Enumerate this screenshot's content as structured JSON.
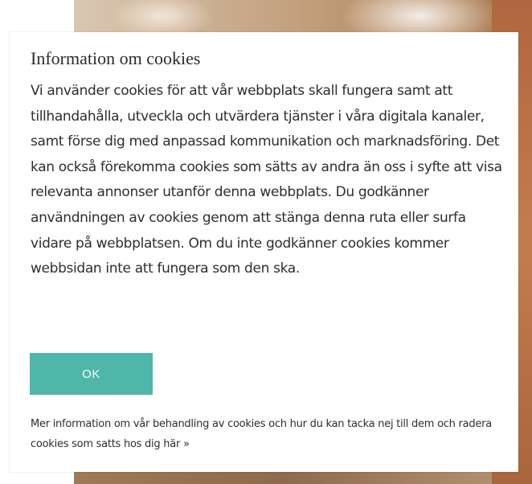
{
  "dialog": {
    "title": "Information om cookies",
    "body": "Vi använder cookies för att vår webbplats skall fungera samt att tillhandahålla, utveckla och utvärdera tjänster i våra digitala kanaler, samt förse dig med anpassad kommunikation och marknadsföring. Det kan också förekomma cookies som sätts av andra än oss i syfte att visa relevanta annonser utanför denna webbplats. Du godkänner användningen av cookies genom att stänga denna ruta eller surfa vidare på webbplatsen. Om du inte godkänner cookies kommer webbsidan inte att fungera som den ska.",
    "ok_label": "OK",
    "more_info_link": "Mer information om vår behandling av cookies och hur du kan tacka nej till dem och radera cookies som satts hos dig här »"
  },
  "colors": {
    "accent": "#4fb6a9",
    "text": "#2e2e2e",
    "dialog_background": "#ffffff"
  }
}
